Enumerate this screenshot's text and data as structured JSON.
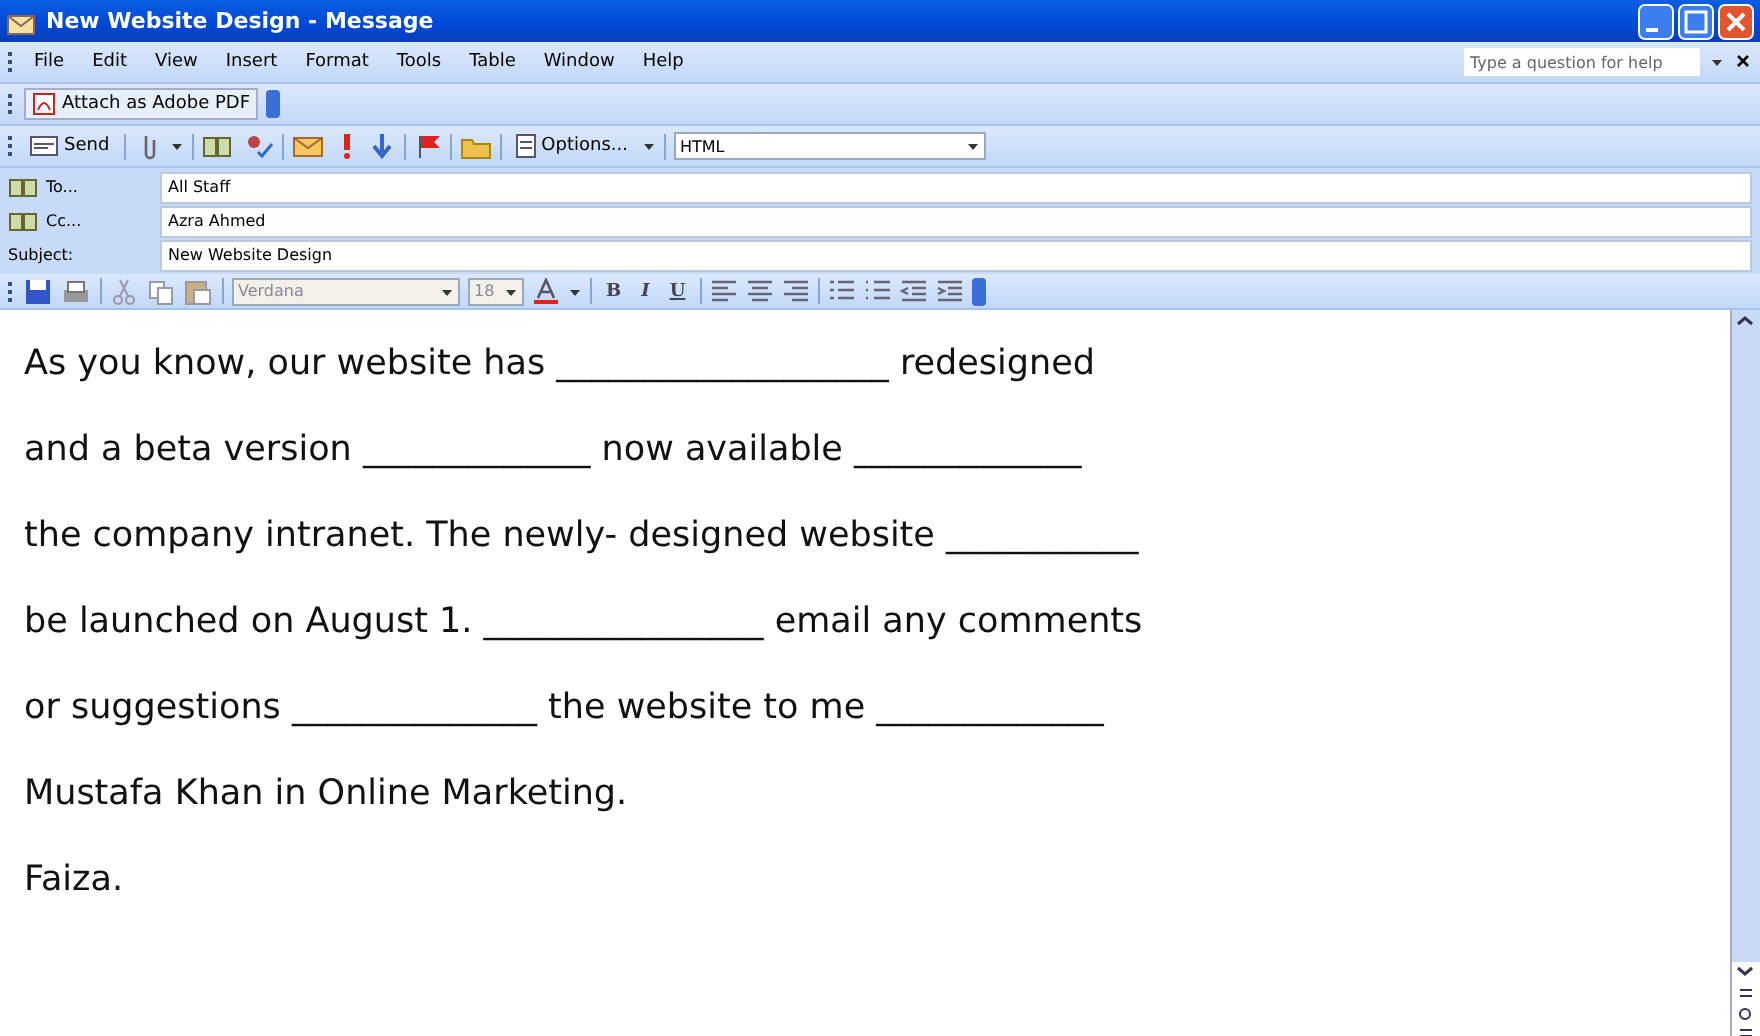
{
  "window": {
    "title": "New Website Design - Message"
  },
  "menu": [
    "File",
    "Edit",
    "View",
    "Insert",
    "Format",
    "Tools",
    "Table",
    "Window",
    "Help"
  ],
  "help_box": {
    "placeholder": "Type a question for help"
  },
  "pdf_toolbar": {
    "button": "Attach as Adobe PDF"
  },
  "send_toolbar": {
    "send": "Send",
    "options": "Options...",
    "format": "HTML"
  },
  "fields": [
    {
      "label": "To...",
      "kind": "book",
      "value": "All Staff"
    },
    {
      "label": "Cc...",
      "kind": "book",
      "value": "Azra Ahmed"
    },
    {
      "label": "Subject:",
      "kind": "plain",
      "value": "New Website Design"
    }
  ],
  "format_toolbar": {
    "font": "Verdana",
    "size": "18",
    "bold": "B",
    "italic": "I",
    "underline": "U"
  },
  "body": [
    "As you know, our website has ___________________ redesigned",
    "and a beta version _____________ now available _____________",
    "the company intranet. The newly- designed website ___________",
    "be launched on August 1. ________________ email any comments",
    "or suggestions ______________ the website to me _____________",
    "Mustafa Khan in Online Marketing.",
    "Faiza."
  ]
}
